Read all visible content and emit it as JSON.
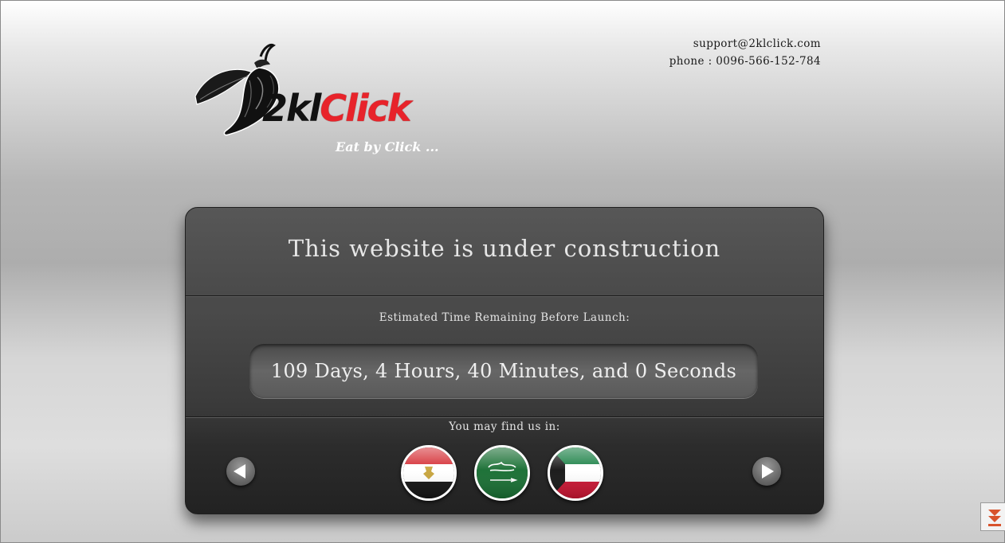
{
  "logo": {
    "word_black": "2kl",
    "word_red": "Click",
    "tagline": "Eat by Click ..."
  },
  "contact": {
    "email": "support@2klclick.com",
    "phone": "phone : 0096-566-152-784"
  },
  "panel": {
    "title": "This website is under construction",
    "estimate_label": "Estimated Time Remaining Before Launch:",
    "countdown": "109 Days, 4 Hours, 40 Minutes, and 0 Seconds",
    "find_label": "You may find us in:"
  },
  "flags": [
    {
      "country": "Egypt",
      "icon": "egypt-flag-icon"
    },
    {
      "country": "Saudi Arabia",
      "icon": "saudi-flag-icon"
    },
    {
      "country": "Kuwait",
      "icon": "kuwait-flag-icon"
    }
  ],
  "colors": {
    "brand_red": "#e8232a",
    "panel_dark": "#3a3a3a",
    "text_light": "#e6e6e6"
  }
}
